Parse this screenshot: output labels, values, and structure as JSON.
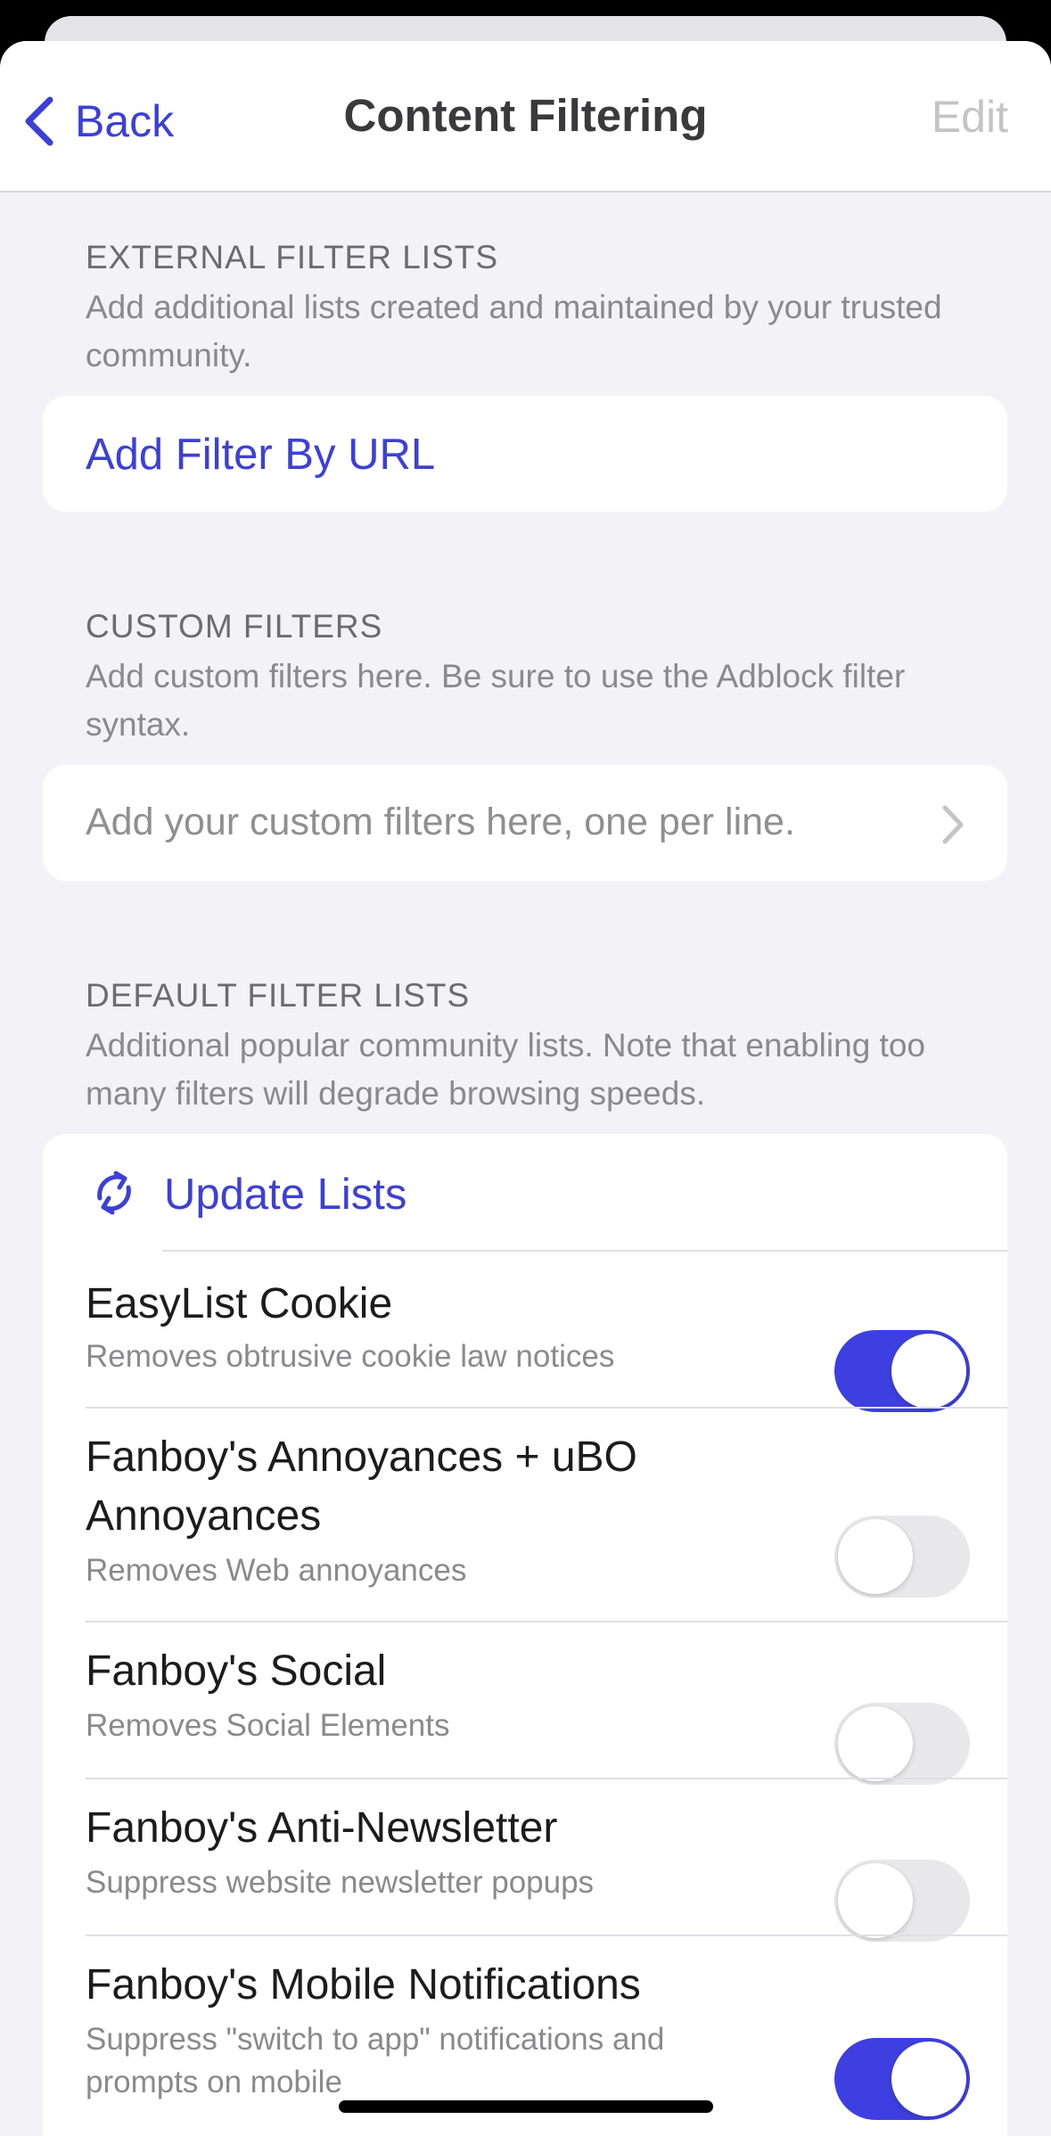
{
  "nav": {
    "back_label": "Back",
    "title": "Content Filtering",
    "edit_label": "Edit"
  },
  "external": {
    "header": "EXTERNAL FILTER LISTS",
    "footer": "Add additional lists created and maintained by your trusted community.",
    "add_label": "Add Filter By URL"
  },
  "custom": {
    "header": "CUSTOM FILTERS",
    "footer": "Add custom filters here. Be sure to use the Adblock filter syntax.",
    "placeholder": "Add your custom filters here, one per line."
  },
  "default_lists": {
    "header": "DEFAULT FILTER LISTS",
    "footer": "Additional popular community lists. Note that enabling too many filters will degrade browsing speeds.",
    "update_label": "Update Lists",
    "items": [
      {
        "title": "EasyList Cookie",
        "subtitle": "Removes obtrusive cookie law notices",
        "enabled": true
      },
      {
        "title": "Fanboy's Annoyances + uBO Annoyances",
        "subtitle": "Removes Web annoyances",
        "enabled": false
      },
      {
        "title": "Fanboy's Social",
        "subtitle": "Removes Social Elements",
        "enabled": false
      },
      {
        "title": "Fanboy's Anti-Newsletter",
        "subtitle": "Suppress website newsletter popups",
        "enabled": false
      },
      {
        "title": "Fanboy's Mobile Notifications",
        "subtitle": "Suppress \"switch to app\" notifications and prompts on mobile",
        "enabled": true
      }
    ]
  },
  "colors": {
    "accent": "#3d3fd9",
    "toggle_on": "#3d3fe0",
    "toggle_off": "#e8e8ea",
    "background": "#f2f2f7"
  },
  "icons": [
    "chevron-left-icon",
    "chevron-right-icon",
    "refresh-icon"
  ]
}
